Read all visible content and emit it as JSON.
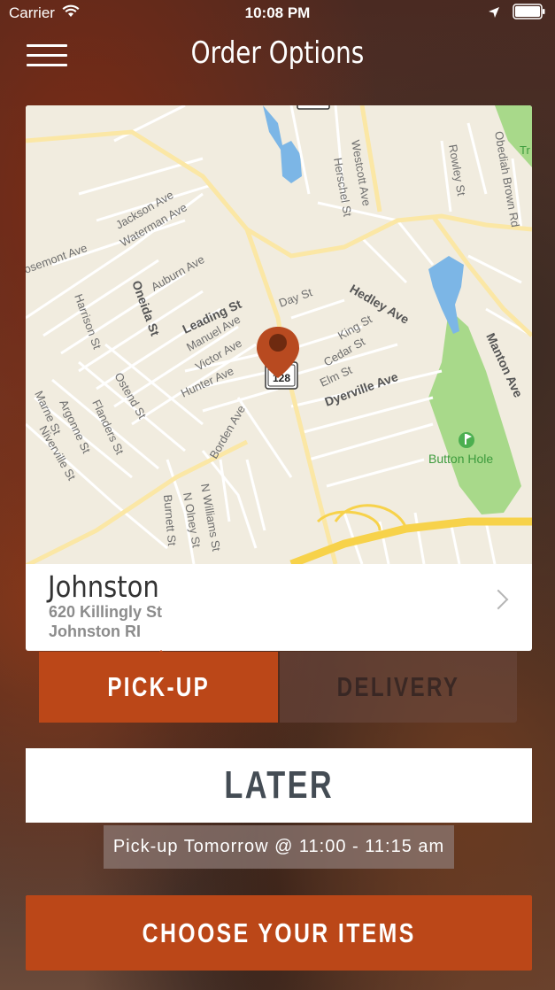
{
  "status_bar": {
    "carrier": "Carrier",
    "time": "10:08 PM"
  },
  "nav": {
    "title": "Order Options"
  },
  "map": {
    "route_shield": "128",
    "street_labels": {
      "jackson": "Jackson Ave",
      "waterman": "Waterman Ave",
      "rosemont": "osemont Ave",
      "auburn": "Auburn Ave",
      "oneida": "Oneida St",
      "harrison": "Harrison St",
      "leading": "Leading St",
      "manuel": "Manuel Ave",
      "victor": "Victor Ave",
      "hunter": "Hunter Ave",
      "day": "Day St",
      "hedley": "Hedley Ave",
      "king": "King St",
      "cedar": "Cedar St",
      "elm": "Elm St",
      "dyerville": "Dyerville Ave",
      "herschel": "Herschel St",
      "westcott": "Westcott Ave",
      "rowley": "Rowley St",
      "obediah": "Obediah Brown Rd",
      "manton": "Manton Ave",
      "marne": "Marne St",
      "argonne": "Argonne St",
      "niverville": "Niverville St",
      "flanders": "Flanders St",
      "ostend": "Ostend St",
      "borden": "Borden Ave",
      "nwilliams": "N Williams St",
      "nolney": "N Olney St",
      "burnett": "Burnett St",
      "park": "Button Hole",
      "tr": "Tr"
    }
  },
  "location": {
    "name": "Johnston",
    "address_line1": "620 Killingly St",
    "address_line2": "Johnston RI"
  },
  "order_type": {
    "pickup_label": "PICK-UP",
    "delivery_label": "DELIVERY"
  },
  "timing": {
    "later_label": "LATER",
    "pickup_time": "Pick-up Tomorrow @ 11:00 - 11:15 am"
  },
  "cta": {
    "choose_label": "CHOOSE YOUR ITEMS"
  },
  "colors": {
    "accent": "#bb4718",
    "map_bg": "#f1ecdf",
    "water": "#7cb6e6",
    "park": "#a8d98a",
    "highway": "#f7d24a"
  }
}
